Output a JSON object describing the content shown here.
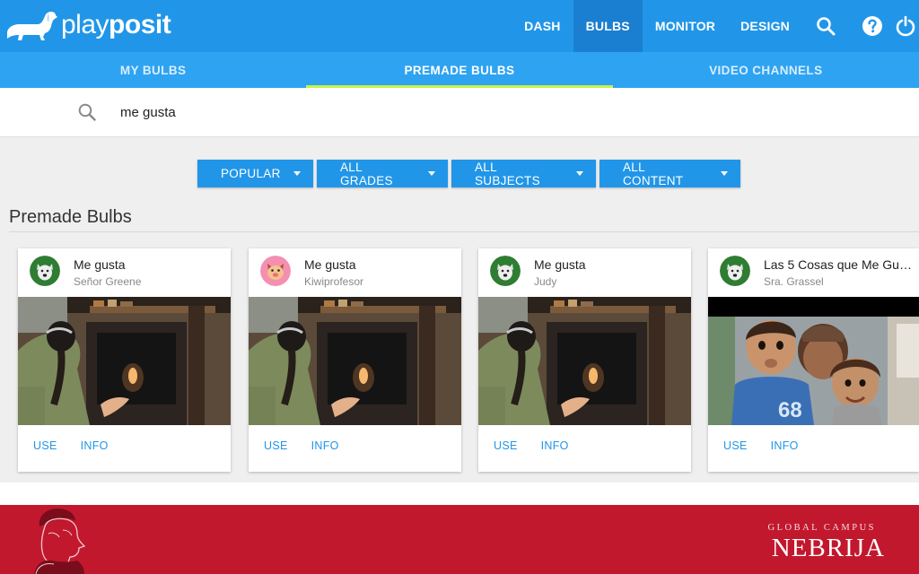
{
  "app": {
    "logo_text_play": "play",
    "logo_text_posit": "posit",
    "logo_icon": "dachshund-logo-icon"
  },
  "nav": {
    "items": [
      {
        "label": "DASH",
        "active": false
      },
      {
        "label": "BULBS",
        "active": true
      },
      {
        "label": "MONITOR",
        "active": false
      },
      {
        "label": "DESIGN",
        "active": false
      }
    ],
    "icons": [
      "search-icon",
      "help-icon",
      "power-icon"
    ]
  },
  "subtabs": [
    {
      "label": "MY BULBS",
      "active": false
    },
    {
      "label": "PREMADE BULBS",
      "active": true
    },
    {
      "label": "VIDEO CHANNELS",
      "active": false
    }
  ],
  "search": {
    "value": "me gusta",
    "icon": "search-icon"
  },
  "filters": [
    {
      "label": "POPULAR"
    },
    {
      "label": "ALL GRADES"
    },
    {
      "label": "ALL SUBJECTS"
    },
    {
      "label": "ALL CONTENT"
    }
  ],
  "section": {
    "title": "Premade Bulbs"
  },
  "cards": [
    {
      "title": "Me gusta",
      "author": "Señor Greene",
      "avatar": "dog-avatar-icon",
      "avatar_color": "#2e7d32",
      "use_label": "USE",
      "info_label": "INFO"
    },
    {
      "title": "Me gusta",
      "author": "Kiwiprofesor",
      "avatar": "pig-avatar-icon",
      "avatar_color": "#f48fb1",
      "use_label": "USE",
      "info_label": "INFO"
    },
    {
      "title": "Me gusta",
      "author": "Judy",
      "avatar": "dog-avatar-icon",
      "avatar_color": "#2e7d32",
      "use_label": "USE",
      "info_label": "INFO"
    },
    {
      "title": "Las 5 Cosas que Me Gus...",
      "author": "Sra. Grassel",
      "avatar": "dog-avatar-icon",
      "avatar_color": "#2e7d32",
      "use_label": "USE",
      "info_label": "INFO"
    }
  ],
  "footer": {
    "campus": "GLOBAL CAMPUS",
    "brand": "NEBRIJA",
    "portrait": "nebrija-portrait-logo",
    "color": "#c2182e"
  },
  "colors": {
    "primary": "#2196e8",
    "subtab_bar": "#2ea3f2",
    "active_indicator": "#c6f24a"
  }
}
